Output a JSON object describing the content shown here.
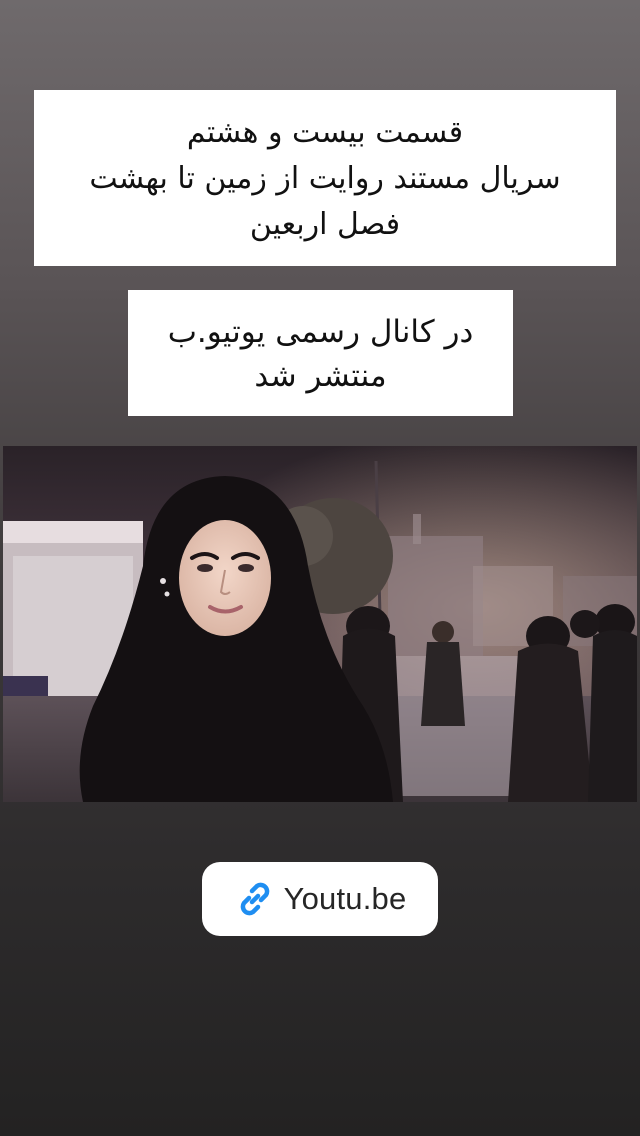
{
  "caption_top": {
    "lines": [
      "قسمت بیست و هشتم",
      "سریال مستند روایت از زمین تا بهشت",
      "فصل اربعین"
    ]
  },
  "caption_bottom": {
    "lines": [
      "در کانال رسمی یوتیو.ب",
      "منتشر شد"
    ]
  },
  "link_sticker": {
    "icon": "link-icon",
    "label": "Youtu.be",
    "accent_color": "#1f8ef1"
  },
  "photo": {
    "subject": "woman-in-black-chador-portrait"
  }
}
